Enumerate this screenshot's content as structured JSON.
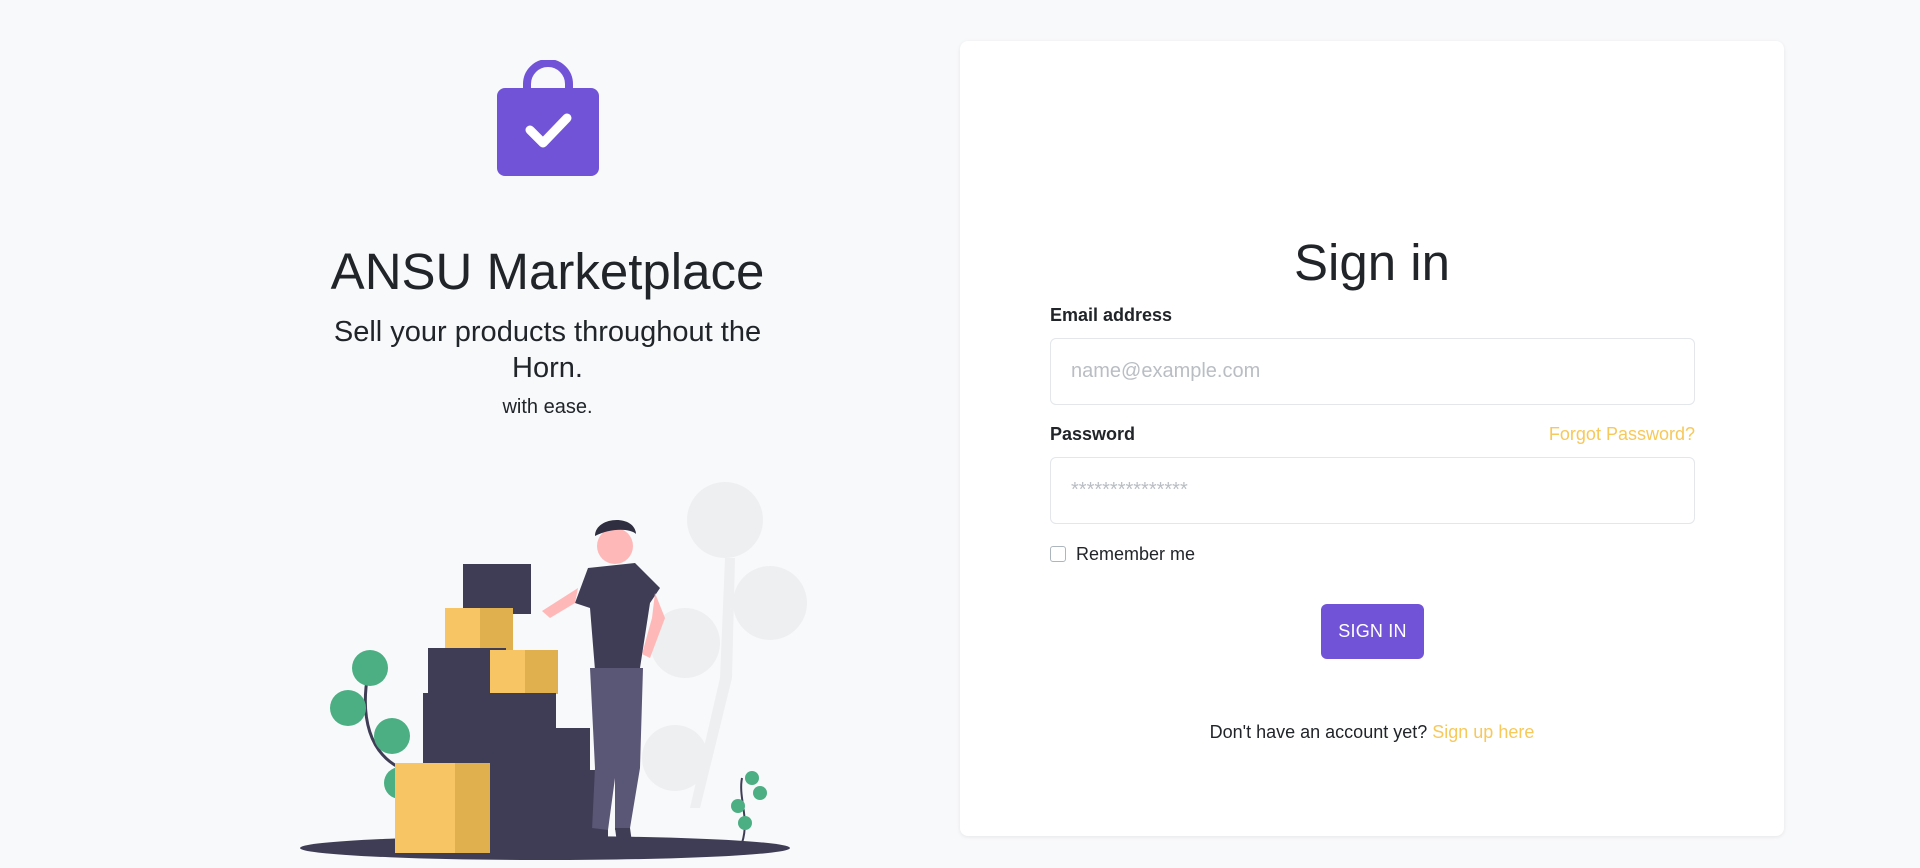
{
  "brand": {
    "title": "ANSU Marketplace",
    "subtitle": "Sell your products throughout the Horn.",
    "tagline": "with ease.",
    "logo_icon": "shopping-bag-check-icon",
    "accent_color": "#7153d8"
  },
  "signin": {
    "title": "Sign in",
    "email_label": "Email address",
    "email_placeholder": "name@example.com",
    "email_value": "",
    "password_label": "Password",
    "password_placeholder": "***************",
    "password_value": "",
    "forgot_link": "Forgot Password?",
    "remember_label": "Remember me",
    "remember_checked": false,
    "submit_label": "SIGN IN",
    "signup_prompt": "Don't have an account yet?",
    "signup_link": "Sign up here",
    "link_color": "#f7c85a"
  }
}
